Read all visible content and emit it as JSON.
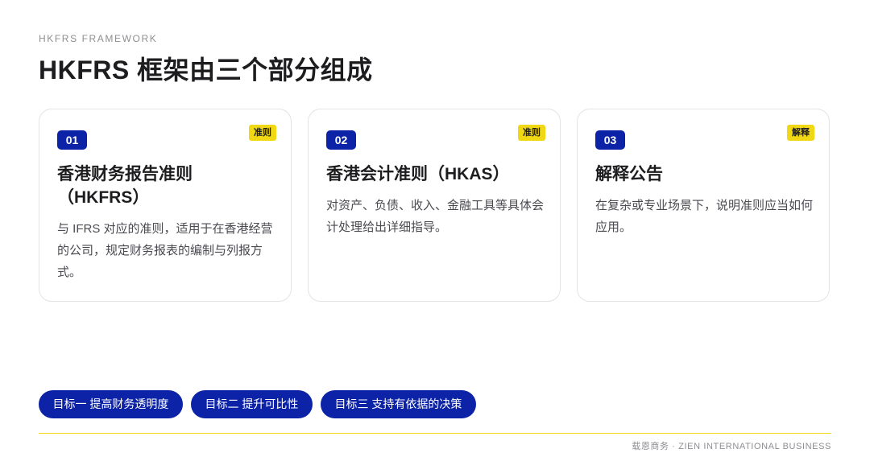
{
  "header": {
    "eyebrow": "HKFRS FRAMEWORK",
    "title": "HKFRS 框架由三个部分组成"
  },
  "cards": [
    {
      "number": "01",
      "tag": "准则",
      "title": "香港财务报告准则（HKFRS）",
      "description": "与 IFRS 对应的准则，适用于在香港经营的公司，规定财务报表的编制与列报方式。"
    },
    {
      "number": "02",
      "tag": "准则",
      "title": "香港会计准则（HKAS）",
      "description": "对资产、负债、收入、金融工具等具体会计处理给出详细指导。"
    },
    {
      "number": "03",
      "tag": "解释",
      "title": "解释公告",
      "description": "在复杂或专业场景下，说明准则应当如何应用。"
    }
  ],
  "goals": [
    "目标一 提高财务透明度",
    "目标二 提升可比性",
    "目标三 支持有依据的决策"
  ],
  "footer": {
    "text": "载恩商务 · ZIEN INTERNATIONAL BUSINESS"
  },
  "colors": {
    "accent_blue": "#0c23a8",
    "accent_yellow": "#f0d815",
    "text_dark": "#1d1d1f",
    "text_muted": "#8e8e93",
    "card_border": "#e3e3e8"
  }
}
